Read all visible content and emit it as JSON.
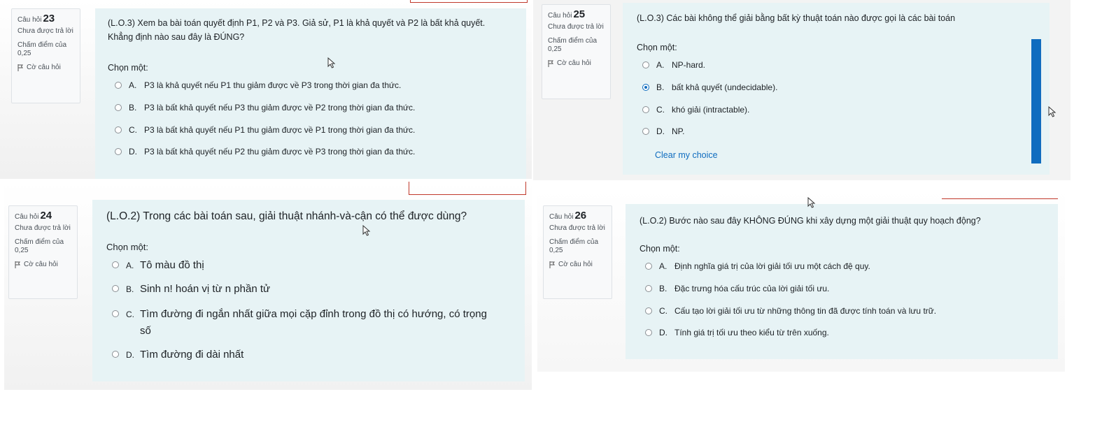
{
  "common": {
    "question_label": "Câu hỏi",
    "state": "Chưa được trả lời",
    "mark": "Chấm điểm của 0,25",
    "flag": "Cờ câu hỏi",
    "prompt": "Chọn một:"
  },
  "q23": {
    "number": "23",
    "text": "(L.O.3) Xem ba bài toán quyết định P1, P2 và P3. Giả sử, P1 là khả quyết và P2 là bất khả quyết. Khẳng định nào sau đây là ĐÚNG?",
    "options": [
      {
        "letter": "A.",
        "text": "P3 là khả quyết nếu P1 thu giảm được về P3 trong thời gian đa thức."
      },
      {
        "letter": "B.",
        "text": "P3 là bất khả quyết nếu P3 thu giảm được về P2 trong thời gian đa thức."
      },
      {
        "letter": "C.",
        "text": "P3 là bất khả quyết nếu P1 thu giảm được về P1 trong thời gian đa thức."
      },
      {
        "letter": "D.",
        "text": "P3 là bất khả quyết nếu P2 thu giảm được về P3 trong thời gian đa thức."
      }
    ]
  },
  "q25": {
    "number": "25",
    "text": "(L.O.3) Các bài không thể giải bằng bất kỳ thuật toán nào được gọi là các bài toán",
    "options": [
      {
        "letter": "A.",
        "text": "NP-hard.",
        "checked": false
      },
      {
        "letter": "B.",
        "text": "bất khả quyết (undecidable).",
        "checked": true
      },
      {
        "letter": "C.",
        "text": "khó giải (intractable).",
        "checked": false
      },
      {
        "letter": "D.",
        "text": "NP.",
        "checked": false
      }
    ],
    "clear_label": "Clear my choice"
  },
  "q24": {
    "number": "24",
    "text": "(L.O.2) Trong các bài toán sau, giải thuật nhánh-và-cận có thể được dùng?",
    "options": [
      {
        "letter": "A.",
        "text": "Tô màu đồ thị"
      },
      {
        "letter": "B.",
        "text": "Sinh n! hoán vị từ n phần tử"
      },
      {
        "letter": "C.",
        "text": "Tìm đường đi ngắn nhất giữa mọi cặp đỉnh trong đồ thị có hướng, có trọng số"
      },
      {
        "letter": "D.",
        "text": "Tìm đường đi dài nhất"
      }
    ]
  },
  "q26": {
    "number": "26",
    "text": "(L.O.2) Bước nào sau đây KHÔNG ĐÚNG khi xây dựng một giải thuật quy hoạch động?",
    "options": [
      {
        "letter": "A.",
        "text": "Định nghĩa giá trị của lời giải tối ưu một cách đệ quy."
      },
      {
        "letter": "B.",
        "text": "Đặc trưng hóa cấu trúc của lời giải tối ưu."
      },
      {
        "letter": "C.",
        "text": "Cấu tạo lời giải tối ưu từ những thông tin đã được tính toán và lưu trữ."
      },
      {
        "letter": "D.",
        "text": "Tính giá trị tối ưu theo kiểu từ trên xuống."
      }
    ]
  },
  "colors": {
    "content_bg": "#e7f3f5",
    "panel_bg": "#f4f4f4",
    "accent": "#0f6cbf",
    "flag_line": "#c0392b"
  }
}
